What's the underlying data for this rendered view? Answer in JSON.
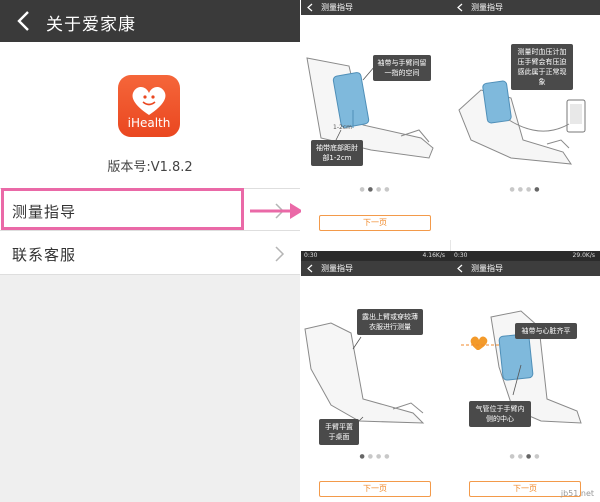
{
  "about_screen": {
    "title": "关于爱家康",
    "app_logo_text": "iHealth",
    "version": "版本号:V1.8.2",
    "menu": [
      {
        "label": "测量指导",
        "highlighted": true
      },
      {
        "label": "联系客服",
        "highlighted": false
      }
    ]
  },
  "guide_panels": [
    {
      "nav_title": "测量指导",
      "callouts": [
        "袖带与手臂间留一指的空间",
        "袖带底部距肘部1-2cm"
      ],
      "annotation": "1-2cm",
      "page_index": 2,
      "next_label": "下一页"
    },
    {
      "nav_title": "测量指导",
      "callouts": [
        "测量时血压计加压手臂会有压迫感此属于正常现象"
      ],
      "page_index": 4,
      "next_label": ""
    },
    {
      "status_time": "0:30",
      "status_network": "4.16K/s",
      "nav_title": "测量指导",
      "callouts": [
        "露出上臂或穿较薄衣服进行测量",
        "手臂平置于桌面"
      ],
      "page_index": 1,
      "next_label": "下一页"
    },
    {
      "status_time": "0:30",
      "status_network": "29.0K/s",
      "nav_title": "测量指导",
      "callouts": [
        "袖带与心脏齐平",
        "气管位于手臂内侧的中心"
      ],
      "page_index": 3,
      "next_label": "下一页"
    }
  ],
  "watermark": "jb51.net",
  "colors": {
    "accent_orange": "#f08a2b",
    "highlight_pink": "#ea69a7",
    "cuff_blue": "#7fb9dc",
    "topbar_dark": "#3a3a3a"
  }
}
